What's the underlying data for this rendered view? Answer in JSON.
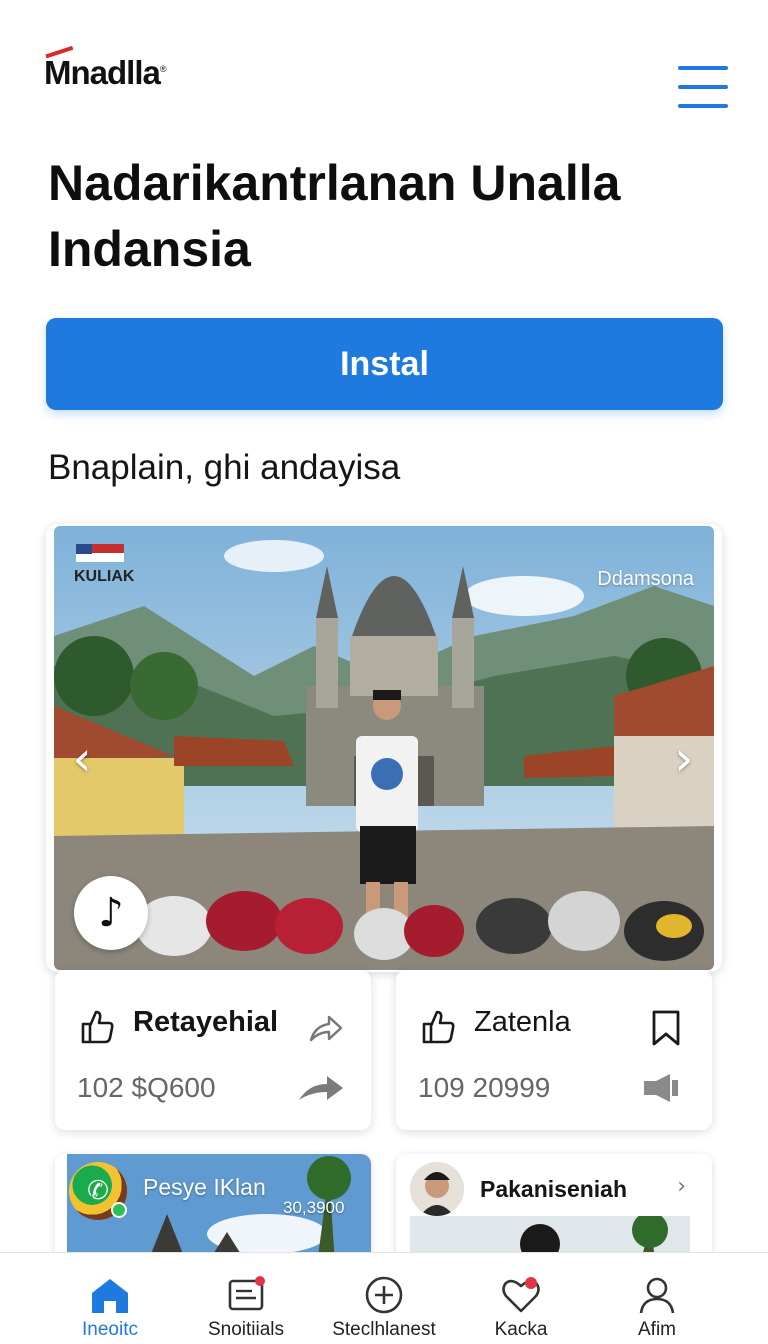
{
  "header": {
    "logo_text": "Mnadlla",
    "logo_reg": "®",
    "menu_icon": "hamburger-menu-icon"
  },
  "headline": "Nadarikantrlanan Unalla Indansia",
  "install_button": {
    "label": "Instal"
  },
  "subtitle": "Bnaplain, ghi andayisa",
  "hero": {
    "flag_label": "KULIAK",
    "place_label": "Ddamsona",
    "prev_icon": "chevron-left-icon",
    "next_icon": "chevron-right-icon",
    "music_icon": "music-note-icon",
    "prev_glyph": "‹",
    "next_glyph": "›",
    "music_glyph": "♪"
  },
  "cards": [
    {
      "title": "Retayehial",
      "value": "102 $Q600",
      "icon": "thumbs-up-icon",
      "action": "share-arrow-icon",
      "action2": "forward-arrow-icon"
    },
    {
      "title": "Zatenla",
      "value": "109 20999",
      "icon": "thumbs-up-icon",
      "action": "bookmark-icon",
      "action2": "speaker-icon"
    }
  ],
  "mini_cards": [
    {
      "name": "Pesye IKlan",
      "price": "30,3900",
      "avatar_glyph": "✆"
    },
    {
      "name": "Pakaniseniah",
      "chevron": "›"
    }
  ],
  "bottom_nav": [
    {
      "label": "Ineoitc",
      "icon": "home-icon",
      "active": true
    },
    {
      "label": "Snoitiials",
      "icon": "document-icon",
      "active": false
    },
    {
      "label": "Steclhlanest",
      "icon": "plus-circle-icon",
      "active": false
    },
    {
      "label": "Kacka",
      "icon": "heart-icon",
      "active": false
    },
    {
      "label": "Afim",
      "icon": "profile-icon",
      "active": false
    }
  ],
  "colors": {
    "accent": "#1f7ae0",
    "text": "#111111",
    "muted": "#666666",
    "logo_mark": "#d62b2b"
  }
}
